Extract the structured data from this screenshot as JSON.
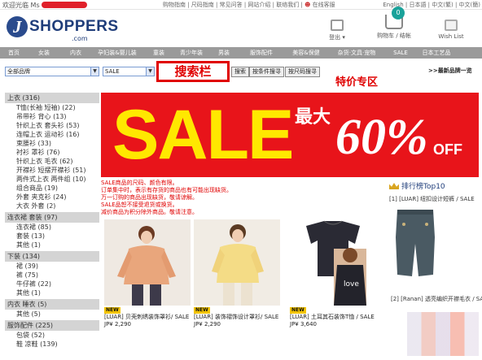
{
  "topbar": {
    "welcome": "欢迎光临 Ms",
    "links": "购物指南 | 尺码指南 | 常见问答 | 网站介绍 | 联络我们 |",
    "service": "在线客服",
    "langs": "English | 日本語 | 中文(繁) | 中文(簡)"
  },
  "header": {
    "logo_letter": "J",
    "logo_text": "SHOPPERS",
    "logo_sub": ".com",
    "logout": "登出 ▾",
    "cart": "购物车 / 结帐",
    "cart_count": "0",
    "wish": "Wish List"
  },
  "nav": [
    "首页",
    "女装",
    "内衣",
    "孕妇装&婴儿装",
    "童装",
    "青少年装",
    "男装",
    "服饰配件",
    "美容&保健",
    "杂货·文具·宠物",
    "SALE",
    "日本工艺品"
  ],
  "search": {
    "brand_select": "全部品牌",
    "category_select": "SALE",
    "label": "搜索栏",
    "buttons": [
      "搜索",
      "按条件搜寻",
      "按尺码搜寻"
    ],
    "special": "特价专区",
    "brand_link": ">>最新品牌一览"
  },
  "sidebar": [
    {
      "header": "上衣 (316)",
      "items": [
        "T恤(长袖 短袖) (22)",
        "吊带衫 背心 (13)",
        "针织上衣 套头衫 (53)",
        "连帽上衣 运动衫 (16)",
        "束腰衫 (33)",
        "衬衫 罩衫 (76)",
        "针织上衣 毛衣 (62)",
        "开襟衫 短摆开襟衫 (51)",
        "两件式上衣 两件组 (10)",
        "组合商品 (19)",
        "外套 夹克衫 (24)",
        "大衣 外套 (2)"
      ]
    },
    {
      "header": "连衣裙 套装 (97)",
      "items": [
        "连衣裙 (85)",
        "套装 (13)",
        "其他 (1)"
      ]
    },
    {
      "header": "下装 (134)",
      "items": [
        "裙 (39)",
        "裤 (75)",
        "牛仔裤 (22)",
        "其他 (1)"
      ]
    },
    {
      "header": "内衣 睡衣 (5)",
      "items": [
        "其他 (5)"
      ]
    },
    {
      "header": "服饰配件 (225)",
      "items": [
        "包袋 (52)",
        "鞋 凉鞋 (139)"
      ]
    }
  ],
  "banner": {
    "sale": "SALE",
    "max": "最大",
    "percent": "60%",
    "off": "OFF"
  },
  "notes": [
    "SALE商品的尺码、颜色有限。",
    "订单集中时，表示有存货的商品也有可能出现缺货。",
    "万一订购的商品出现缺货，敬请谅解。",
    "SALE品恕不接受退货或换货。",
    "减价商品为积分除外商品。敬请注意。"
  ],
  "products": [
    {
      "badge": "NEW",
      "name": "[LUAR] 贝壳刺绣装饰罩衫/ SALE",
      "price": "JP¥ 2,290"
    },
    {
      "badge": "NEW",
      "name": "[LUAR] 装饰褶饰设计罩衫/ SALE",
      "price": "JP¥ 2,290"
    },
    {
      "badge": "NEW",
      "name": "[LUAR] 土耳其石装饰T恤 / SALE",
      "price": "JP¥ 3,640"
    }
  ],
  "ranking": {
    "title": "排行榜Top10",
    "item1": "[1] [LUAR] 纽扣设计短裤 / SALE",
    "item2": "[2] [Ranan] 透亮编织开襟毛衣 / SALE"
  },
  "colors": {
    "accent_red": "#e8141a",
    "nav_gray": "#9a9a9a",
    "brand_blue": "#1f3d7a",
    "sale_yellow": "#ffe800",
    "cart_badge": "#1aa29a"
  }
}
